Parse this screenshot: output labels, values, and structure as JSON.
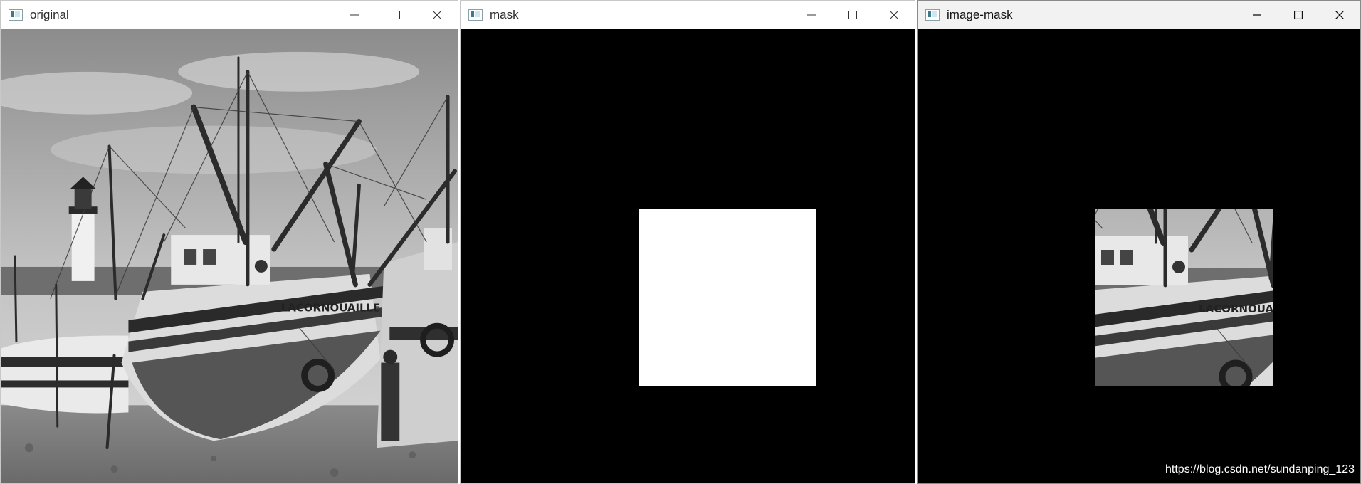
{
  "windows": [
    {
      "title": "original"
    },
    {
      "title": "mask"
    },
    {
      "title": "image-mask"
    }
  ],
  "boat_lettering": "LA CORNOUAILLE",
  "watermark": "https://blog.csdn.net/sundanping_123",
  "colors": {
    "mask_background": "#000000",
    "mask_region": "#ffffff",
    "titlebar": "#ffffff",
    "titlebar_inactive": "#f2f2f2"
  },
  "icons": [
    "app-icon",
    "minimize-icon",
    "maximize-icon",
    "close-icon"
  ]
}
